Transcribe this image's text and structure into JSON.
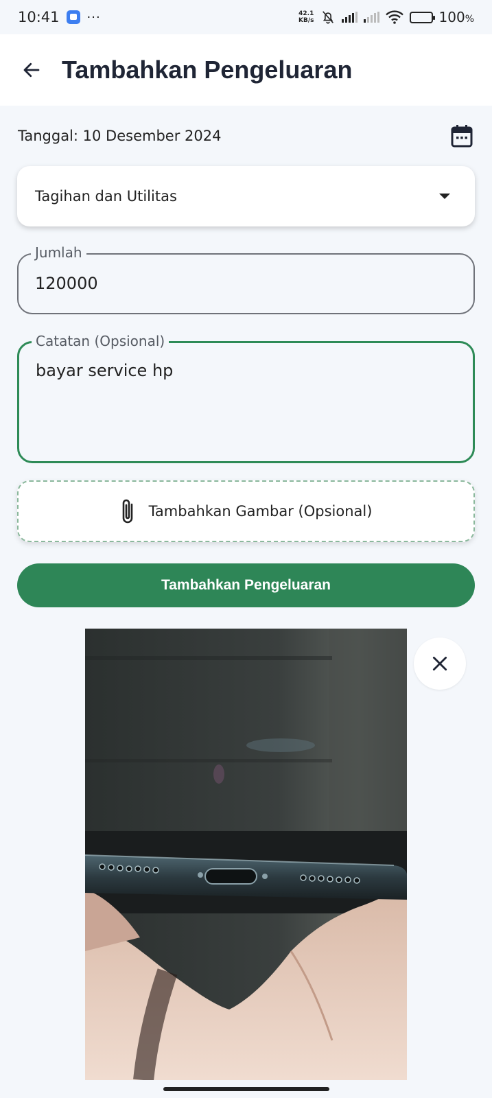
{
  "status_bar": {
    "time": "10:41",
    "dots": "···",
    "net_speed_value": "42.1",
    "net_speed_unit": "KB/s",
    "battery": "100",
    "battery_unit": "%",
    "battery_level": 1.0
  },
  "header": {
    "title": "Tambahkan Pengeluaran",
    "back_icon": "arrow-left-icon"
  },
  "form": {
    "date_text": "Tanggal: 10 Desember 2024",
    "calendar_icon": "calendar-icon",
    "category": "Tagihan dan Utilitas",
    "amount_label": "Jumlah",
    "amount_value": "120000",
    "notes_label": "Catatan (Opsional)",
    "notes_value": "bayar service hp",
    "attach_label": "Tambahkan Gambar (Opsional)",
    "attach_icon": "paperclip-icon",
    "submit_label": "Tambahkan Pengeluaran"
  },
  "preview": {
    "close_icon": "close-icon"
  },
  "colors": {
    "primary": "#2e8657",
    "focus_border": "#2e8b57",
    "background": "#f4f7fb"
  }
}
